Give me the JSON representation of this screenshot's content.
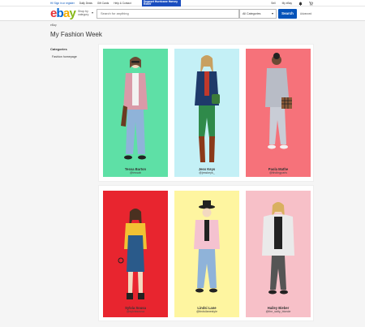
{
  "topbar": {
    "greeting": "Hi! Sign in or register",
    "daily_deals": "Daily Deals",
    "gift_cards": "Gift Cards",
    "help_contact": "Help & Contact",
    "promo": "Support Hurricane Harvey Relief",
    "sell": "Sell",
    "my_ebay": "My eBay"
  },
  "header": {
    "logo_letters": [
      "e",
      "b",
      "a",
      "y"
    ],
    "shop_by": "Shop by category",
    "search_placeholder": "Search for anything",
    "category": "All Categories",
    "search_button": "Search",
    "advanced": "Advanced"
  },
  "breadcrumb": "eBay",
  "page_title": "My Fashion Week",
  "sidebar": {
    "heading": "Categories",
    "items": [
      {
        "label": "Fashion homepage"
      }
    ]
  },
  "cards": [
    {
      "name": "Tessa Barton",
      "handle": "@tessab",
      "color": "#5ee0a6"
    },
    {
      "name": "Jess Keys",
      "handle": "@jesskeys_",
      "color": "#c4f0f6"
    },
    {
      "name": "Paola Mathe",
      "handle": "@findingparis",
      "color": "#f6727a"
    },
    {
      "name": "Sylvia Sousa",
      "handle": "@sylviasousa",
      "color": "#e8252f"
    },
    {
      "name": "Lindsi Lane",
      "handle": "@lindsilanestyle",
      "color": "#fef5a0"
    },
    {
      "name": "Hailey Bieber",
      "handle": "@the_salty_blonde",
      "color": "#f7c0c8"
    }
  ],
  "colors": {
    "ebay_blue": "#0654ba",
    "ebay_red": "#e53238",
    "ebay_yellow": "#f5af02",
    "ebay_green": "#86b817"
  }
}
